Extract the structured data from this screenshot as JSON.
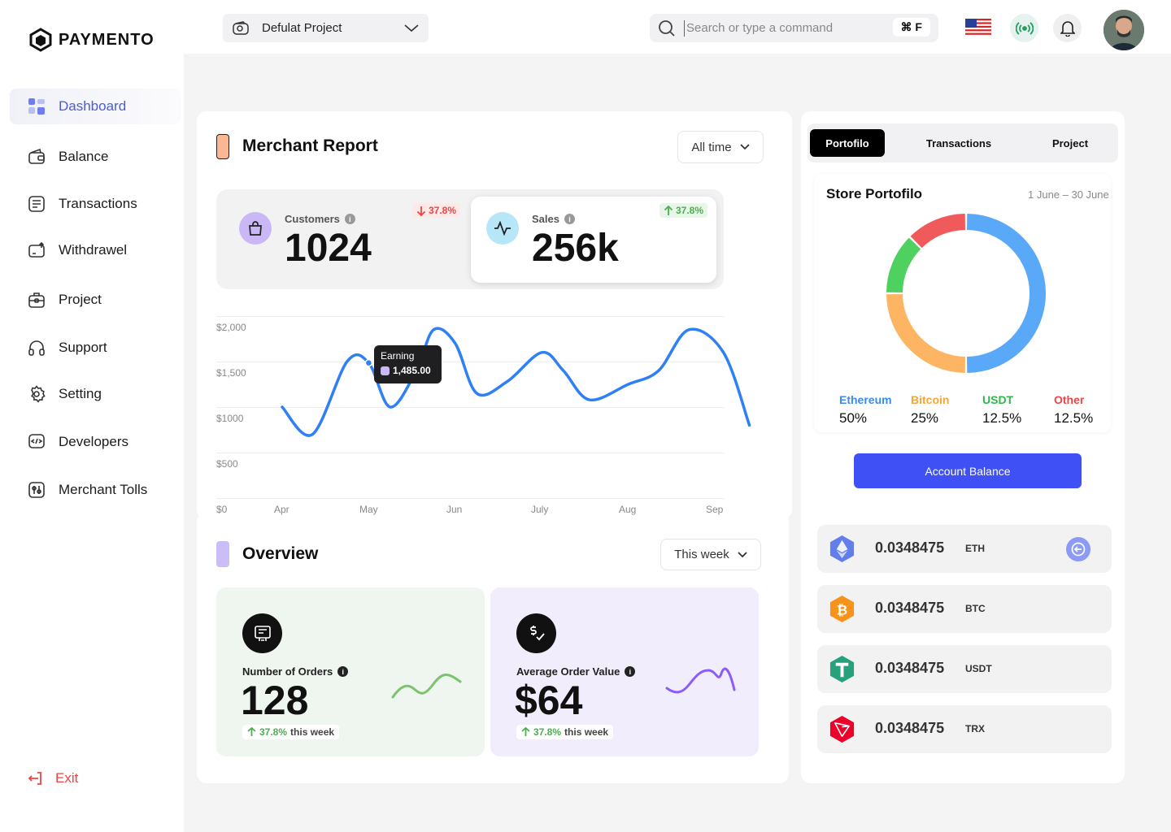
{
  "brand": {
    "name": "PAYMENTO"
  },
  "sidebar": {
    "items": [
      {
        "label": "Dashboard",
        "icon": "dashboard-icon",
        "active": true
      },
      {
        "label": "Balance",
        "icon": "wallet-icon"
      },
      {
        "label": "Transactions",
        "icon": "receipt-icon"
      },
      {
        "label": "Withdrawel",
        "icon": "withdraw-icon"
      },
      {
        "label": "Project",
        "icon": "briefcase-icon"
      },
      {
        "label": "Support",
        "icon": "headset-icon"
      },
      {
        "label": "Setting",
        "icon": "gear-icon"
      },
      {
        "label": "Developers",
        "icon": "code-icon"
      },
      {
        "label": "Merchant Tolls",
        "icon": "tools-icon"
      }
    ],
    "exit_label": "Exit"
  },
  "topbar": {
    "project_label": "Defulat Project",
    "search_placeholder": "Search or type a command",
    "search_shortcut": "⌘ F"
  },
  "merchant": {
    "title": "Merchant Report",
    "range_label": "All time",
    "customers": {
      "label": "Customers",
      "value": "1024",
      "change": "37.8%",
      "direction": "down"
    },
    "sales": {
      "label": "Sales",
      "value": "256k",
      "change": "37.8%",
      "direction": "up"
    },
    "tooltip": {
      "title": "Earning",
      "value": "1,485.00"
    }
  },
  "chart_data": {
    "type": "line",
    "x": [
      "Apr",
      "May",
      "Jun",
      "July",
      "Aug",
      "Sep"
    ],
    "y_ticks": [
      "$2,000",
      "$1,500",
      "$1000",
      "$500",
      "$0"
    ],
    "ylim": [
      0,
      2000
    ],
    "series": [
      {
        "points": [
          [
            0.0,
            1000
          ],
          [
            0.35,
            700
          ],
          [
            0.75,
            1500
          ],
          [
            1.0,
            1485
          ],
          [
            1.25,
            1000
          ],
          [
            1.55,
            1400
          ],
          [
            1.75,
            1850
          ],
          [
            2.0,
            1700
          ],
          [
            2.25,
            1150
          ],
          [
            2.6,
            1280
          ],
          [
            3.0,
            1600
          ],
          [
            3.25,
            1400
          ],
          [
            3.55,
            1080
          ],
          [
            4.0,
            1250
          ],
          [
            4.35,
            1400
          ],
          [
            4.7,
            1850
          ],
          [
            5.1,
            1600
          ],
          [
            5.4,
            800
          ]
        ],
        "color": "#2f7ff5"
      }
    ]
  },
  "overview": {
    "title": "Overview",
    "range_label": "This week",
    "orders": {
      "label": "Number of Orders",
      "value": "128",
      "change": "37.8%",
      "change_suffix": "this week"
    },
    "aov": {
      "label": "Average Order Value",
      "value": "$64",
      "change": "37.8%",
      "change_suffix": "this week"
    }
  },
  "portfolio": {
    "tabs": [
      "Portofilo",
      "Transactions",
      "Project"
    ],
    "title": "Store Portofilo",
    "date_range": "1 June – 30 June",
    "slices": [
      {
        "name": "Ethereum",
        "value": 50,
        "label": "50%",
        "color": "#5aa8f8"
      },
      {
        "name": "Bitcoin",
        "value": 25,
        "label": "25%",
        "color": "#fdb564"
      },
      {
        "name": "USDT",
        "value": 12.5,
        "label": "12.5%",
        "color": "#4fd15f"
      },
      {
        "name": "Other",
        "value": 12.5,
        "label": "12.5%",
        "color": "#f05a5a"
      }
    ],
    "button_label": "Account Balance",
    "coins": [
      {
        "amount": "0.0348475",
        "symbol": "ETH",
        "color": "#627eea"
      },
      {
        "amount": "0.0348475",
        "symbol": "BTC",
        "color": "#f7931a"
      },
      {
        "amount": "0.0348475",
        "symbol": "USDT",
        "color": "#26a17b"
      },
      {
        "amount": "0.0348475",
        "symbol": "TRX",
        "color": "#eb0029"
      }
    ]
  }
}
